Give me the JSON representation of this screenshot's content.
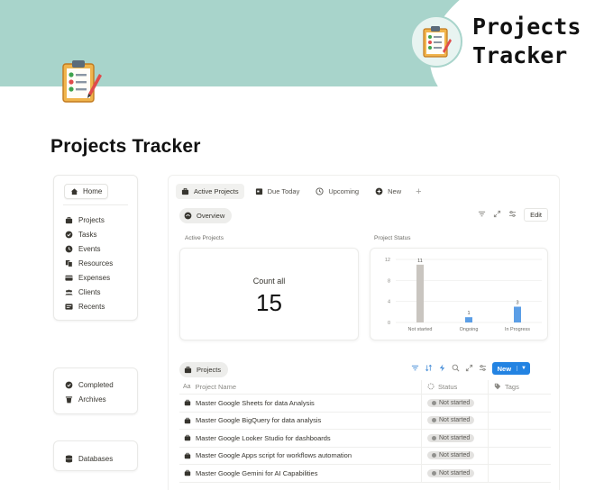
{
  "banner": {
    "brand_title": "Projects\nTracker"
  },
  "page": {
    "title": "Projects Tracker"
  },
  "sidebar": {
    "home_label": "Home",
    "items": [
      {
        "label": "Projects",
        "icon": "briefcase-icon"
      },
      {
        "label": "Tasks",
        "icon": "check-circle-icon"
      },
      {
        "label": "Events",
        "icon": "clock-icon"
      },
      {
        "label": "Resources",
        "icon": "folder-icon"
      },
      {
        "label": "Expenses",
        "icon": "card-icon"
      },
      {
        "label": "Clients",
        "icon": "people-icon"
      },
      {
        "label": "Recents",
        "icon": "inbox-icon"
      }
    ],
    "secondary": [
      {
        "label": "Completed",
        "icon": "check-badge-icon"
      },
      {
        "label": "Archives",
        "icon": "trash-icon"
      }
    ],
    "databases_label": "Databases"
  },
  "main": {
    "tabs": [
      {
        "label": "Active Projects",
        "icon": "briefcase-icon",
        "active": true
      },
      {
        "label": "Due Today",
        "icon": "calendar-icon",
        "active": false
      },
      {
        "label": "Upcoming",
        "icon": "clock-icon",
        "active": false
      },
      {
        "label": "New",
        "icon": "plus-circle-icon",
        "active": false
      }
    ],
    "overview_label": "Overview",
    "edit_label": "Edit",
    "active_projects_label": "Active Projects",
    "project_status_label": "Project Status",
    "count_label": "Count all",
    "count_value": "15",
    "projects_label": "Projects",
    "new_button_label": "New",
    "columns": {
      "name": "Project Name",
      "status": "Status",
      "tags": "Tags"
    },
    "rows": [
      {
        "name": "Master Google Sheets for data Analysis",
        "status": "Not started"
      },
      {
        "name": "Master Google BigQuery for data analysis",
        "status": "Not started"
      },
      {
        "name": "Master Google Looker Studio for dashboards",
        "status": "Not started"
      },
      {
        "name": "Master Google Apps script for workflows automation",
        "status": "Not started"
      },
      {
        "name": "Master Google Gemini for AI Capabilities",
        "status": "Not started"
      }
    ]
  },
  "chart_data": {
    "type": "bar",
    "categories": [
      "Not started",
      "Ongoing",
      "In Progress"
    ],
    "values": [
      11,
      1,
      3
    ],
    "ylim": [
      0,
      12
    ],
    "yticks": [
      "0",
      "4",
      "8",
      "12"
    ],
    "colors": [
      "#c9c5c0",
      "#5b9ee6",
      "#5b9ee6"
    ],
    "grid": true
  }
}
